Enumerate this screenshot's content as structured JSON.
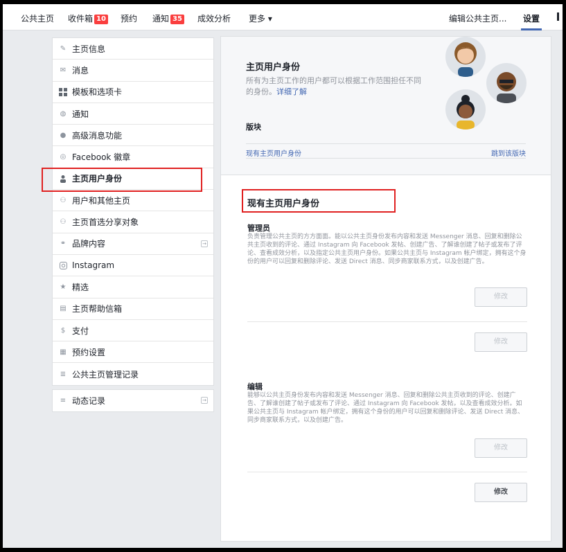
{
  "nav": {
    "home": "公共主页",
    "inbox": "收件箱",
    "inbox_count": "10",
    "publishing": "预约",
    "notifications": "通知",
    "notifications_count": "35",
    "insights": "成效分析",
    "more": "更多 ▾",
    "edit_info": "编辑公共主页...",
    "settings": "设置"
  },
  "sidebar": {
    "items": [
      {
        "label": "主页信息",
        "icon": "pencil-icon"
      },
      {
        "label": "消息",
        "icon": "message-icon"
      },
      {
        "label": "模板和选项卡",
        "icon": "grid-icon"
      },
      {
        "label": "通知",
        "icon": "globe-icon"
      },
      {
        "label": "高级消息功能",
        "icon": "chat-bubble-icon"
      },
      {
        "label": "Facebook 徽章",
        "icon": "badge-icon"
      },
      {
        "label": "主页用户身份",
        "icon": "person-icon"
      },
      {
        "label": "用户和其他主页",
        "icon": "people-icon"
      },
      {
        "label": "主页首选分享对象",
        "icon": "people-icon"
      },
      {
        "label": "品牌内容",
        "icon": "handshake-icon"
      },
      {
        "label": "Instagram",
        "icon": "instagram-icon"
      },
      {
        "label": "精选",
        "icon": "star-icon"
      },
      {
        "label": "主页帮助信箱",
        "icon": "inbox-icon"
      },
      {
        "label": "支付",
        "icon": "dollar-icon"
      },
      {
        "label": "预约设置",
        "icon": "calendar-icon"
      },
      {
        "label": "公共主页管理记录",
        "icon": "log-icon"
      }
    ],
    "activity_log": "动态记录"
  },
  "panel": {
    "title": "主页用户身份",
    "desc": "所有为主页工作的用户都可以根据工作范围担任不同的身份。",
    "learn_more": "详细了解",
    "section_label": "版块",
    "section_link": "现有主页用户身份",
    "jump_link": "跳到该版块"
  },
  "main": {
    "title": "现有主页用户身份",
    "admin_title": "管理员",
    "admin_desc": "负责管理公共主页的方方面面。能以公共主页身份发布内容和发送 Messenger 消息、回复和删除公共主页收到的评论、通过 Instagram 向 Facebook 发帖、创建广告、了解谁创建了帖子或发布了评论、查看成效分析，以及指定公共主页用户身份。如果公共主页与 Instagram 帐户绑定，拥有这个身份的用户可以回复和删除评论、发送 Direct 消息、同步商家联系方式，以及创建广告。",
    "editor_title": "编辑",
    "editor_desc": "能够以公共主页身份发布内容和发送 Messenger 消息、回复和删除公共主页收到的评论、创建广告、了解谁创建了帖子或发布了评论、通过 Instagram 向 Facebook 发帖，以及查看成效分析。如果公共主页与 Instagram 帐户绑定，拥有这个身份的用户可以回复和删除评论、发送 Direct 消息、同步商家联系方式，以及创建广告。",
    "edit_label": "修改"
  }
}
